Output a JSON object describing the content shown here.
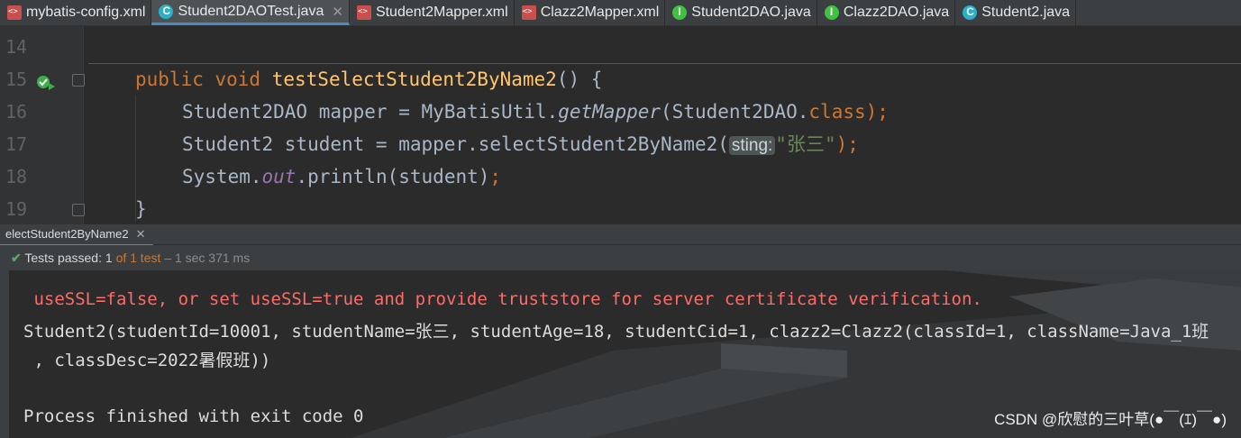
{
  "tabs": [
    {
      "label": "mybatis-config.xml",
      "type": "xml",
      "active": false
    },
    {
      "label": "Student2DAOTest.java",
      "type": "cls",
      "active": true
    },
    {
      "label": "Student2Mapper.xml",
      "type": "xml",
      "active": false
    },
    {
      "label": "Clazz2Mapper.xml",
      "type": "xml",
      "active": false
    },
    {
      "label": "Student2DAO.java",
      "type": "itf",
      "active": false
    },
    {
      "label": "Clazz2DAO.java",
      "type": "itf",
      "active": false
    },
    {
      "label": "Student2.java",
      "type": "cls",
      "active": false
    }
  ],
  "editor": {
    "line_numbers": [
      "14",
      "15",
      "16",
      "17",
      "18",
      "19"
    ],
    "l15": {
      "kw": "public void",
      "fn": "testSelectStudent2ByName2",
      "rest": "() {"
    },
    "l16": {
      "a": "Student2DAO mapper = MyBatisUtil.",
      "b": "getMapper",
      "c": "(Student2DAO.",
      "d": "class",
      "e": ");"
    },
    "l17": {
      "a": "Student2 student = mapper.selectStudent2ByName2(",
      "hint": "sting:",
      "str": "\"张三\"",
      "e": ");"
    },
    "l18": {
      "a": "System.",
      "b": "out",
      "c": ".println(student)",
      "d": ";"
    },
    "l19": {
      "a": "}"
    }
  },
  "run": {
    "tab_label": "electStudent2ByName2",
    "status_prefix": "Tests passed:",
    "status_count": "1",
    "status_of": "of 1 test",
    "status_sep": "–",
    "status_time": "1 sec 371 ms",
    "out_cut": "useSSL=false, or set useSSL=true and provide truststore for server certificate verification.",
    "out_red": " useSSL=false, or set useSSL=true and provide truststore for server certificate verification.",
    "out_line1": "Student2(studentId=10001, studentName=张三, studentAge=18, studentCid=1, clazz2=Clazz2(classId=1, className=Java_1班",
    "out_line2": " , classDesc=2022暑假班))",
    "out_exit": "Process finished with exit code 0"
  },
  "watermark": "CSDN @欣慰的三叶草(●￣(ｴ)￣●)"
}
